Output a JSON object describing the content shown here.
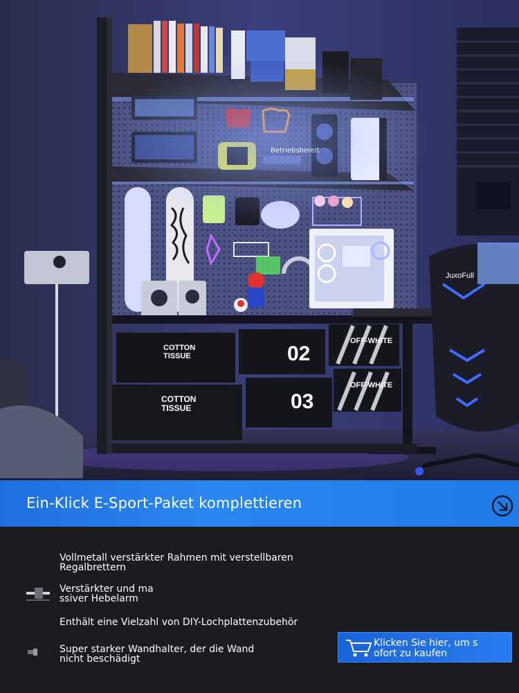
{
  "hero": {
    "status_tag": "Betriebsbereit",
    "boxes": [
      {
        "label": "COTTON\nTISSUE"
      },
      {
        "label": "02"
      },
      {
        "label": "OFF-WHITE"
      },
      {
        "label": "COTTON\nTISSUE"
      },
      {
        "label": "03"
      },
      {
        "label": "OFF-WHITE"
      }
    ],
    "chair_brand": "JuxoFull"
  },
  "banner": {
    "title": "Ein-Klick E-Sport-Paket komplettieren"
  },
  "features": [
    {
      "text_line1": "Vollmetall verstärkter Rahmen mit verstellbaren",
      "text_line2": "Regalbrettern"
    },
    {
      "text_line1": "Verstärkter und ma",
      "text_line2": "ssiver Hebelarm"
    },
    {
      "text_line1": "Enthält eine Vielzahl von DIY-Lochplattenzubehör",
      "text_line2": ""
    },
    {
      "text_line1": "Super starker Wandhalter, der die Wand",
      "text_line2": "nicht beschädigt"
    }
  ],
  "buy_button": {
    "line1": "Klicken Sie hier, um s",
    "line2": "ofort zu kaufen"
  },
  "colors": {
    "banner": "#2a86f0",
    "background": "#1b1c1f",
    "accent_neon": "#5a7dff"
  },
  "icons": {
    "banner": "circle-arrow-down-right-icon",
    "buy": "shopping-cart-icon"
  }
}
